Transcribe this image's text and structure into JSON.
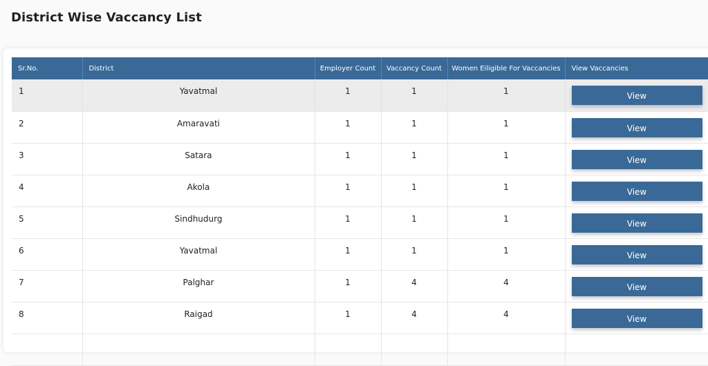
{
  "page": {
    "title": "District Wise Vaccancy List"
  },
  "table": {
    "headers": [
      "Sr.No.",
      "District",
      "Employer Count",
      "Vaccancy Count",
      "Women Eiligible For Vaccancies",
      "View Vaccancies"
    ],
    "view_label": "View",
    "rows": [
      {
        "srno": "1",
        "district": "Yavatmal",
        "employer_count": "1",
        "vaccancy_count": "1",
        "women_eligible": "1"
      },
      {
        "srno": "2",
        "district": "Amaravati",
        "employer_count": "1",
        "vaccancy_count": "1",
        "women_eligible": "1"
      },
      {
        "srno": "3",
        "district": "Satara",
        "employer_count": "1",
        "vaccancy_count": "1",
        "women_eligible": "1"
      },
      {
        "srno": "4",
        "district": "Akola",
        "employer_count": "1",
        "vaccancy_count": "1",
        "women_eligible": "1"
      },
      {
        "srno": "5",
        "district": "Sindhudurg",
        "employer_count": "1",
        "vaccancy_count": "1",
        "women_eligible": "1"
      },
      {
        "srno": "6",
        "district": "Yavatmal",
        "employer_count": "1",
        "vaccancy_count": "1",
        "women_eligible": "1"
      },
      {
        "srno": "7",
        "district": "Palghar",
        "employer_count": "1",
        "vaccancy_count": "4",
        "women_eligible": "4"
      },
      {
        "srno": "8",
        "district": "Raigad",
        "employer_count": "1",
        "vaccancy_count": "4",
        "women_eligible": "4"
      },
      {
        "srno": "",
        "district": "",
        "employer_count": "",
        "vaccancy_count": "",
        "women_eligible": ""
      }
    ]
  },
  "colors": {
    "header_bg": "#3a6997",
    "button_bg": "#3a6997",
    "highlight_row": "#ececec"
  }
}
